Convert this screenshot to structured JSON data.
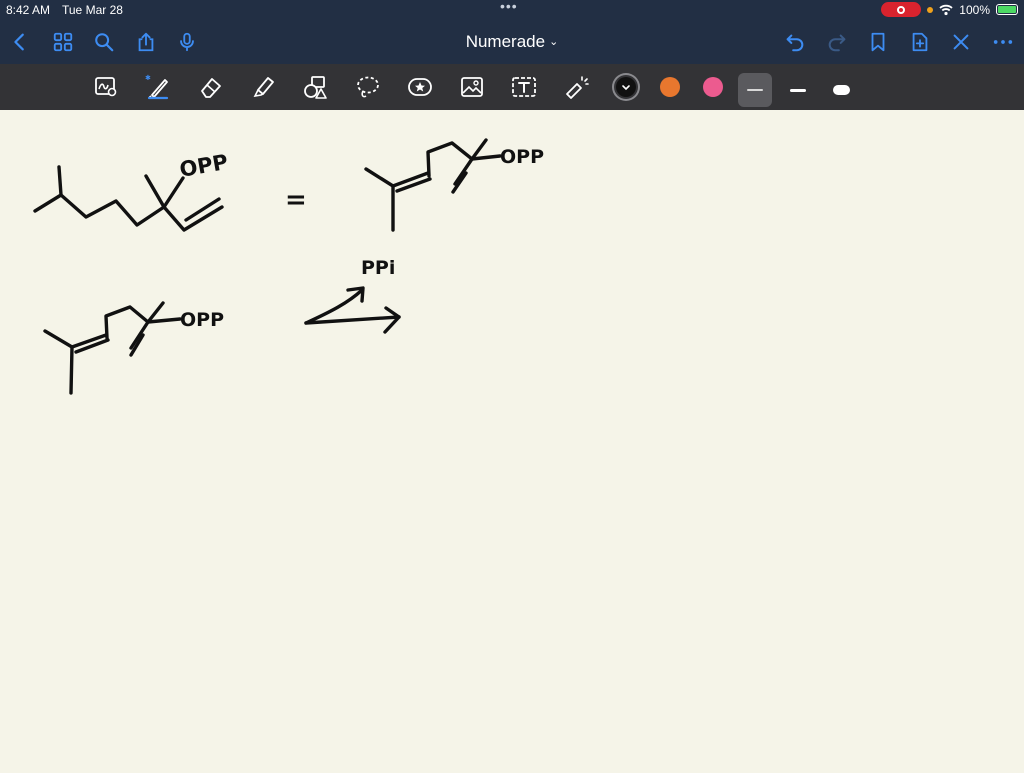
{
  "status_bar": {
    "time": "8:42 AM",
    "date": "Tue Mar 28",
    "battery": "100%",
    "battery_level": 1.0
  },
  "nav": {
    "title": "Numerade",
    "accent_color": "#3d8cf2",
    "icons": [
      "chevron-left-icon",
      "thumbnails-grid-icon",
      "search-icon",
      "share-icon",
      "microphone-icon",
      "undo-icon",
      "redo-icon",
      "bookmark-icon",
      "add-page-icon",
      "close-icon",
      "more-icon"
    ]
  },
  "toolbar": {
    "tools": [
      "lasso-zoom-icon",
      "pen-icon",
      "eraser-icon",
      "highlighter-icon",
      "shapes-icon",
      "lasso-icon",
      "sticker-icon",
      "image-icon",
      "text-icon",
      "laser-pointer-icon"
    ],
    "colors": {
      "black": "#111111",
      "orange": "#e8772e",
      "pink": "#ec5b8f"
    },
    "selected_color": "black",
    "stroke_sizes": [
      "thin",
      "medium",
      "thick"
    ],
    "selected_stroke": "thin"
  },
  "canvas": {
    "background": "#f5f4e8",
    "handwriting": {
      "label_opp_1": "OPP",
      "equals": "=",
      "label_opp_2": "OPP",
      "label_opp_3": "OPP",
      "label_pp": "PPi"
    }
  }
}
